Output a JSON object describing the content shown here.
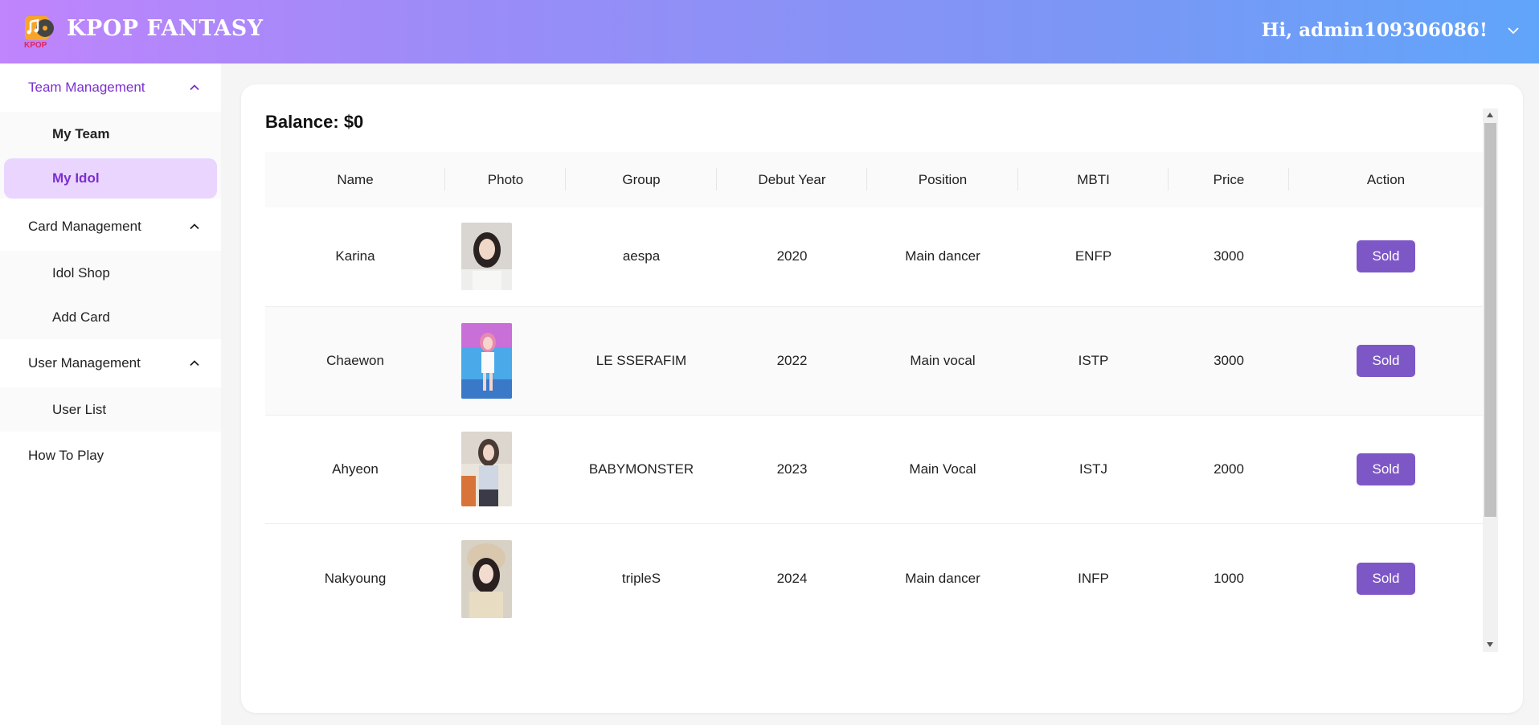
{
  "header": {
    "brand": "KPOP FANTASY",
    "logo_text": "KPOP",
    "greeting": "Hi, admin109306086!"
  },
  "sidebar": {
    "groups": [
      {
        "label": "Team Management",
        "items": [
          "My Team",
          "My Idol"
        ]
      },
      {
        "label": "Card Management",
        "items": [
          "Idol Shop",
          "Add Card"
        ]
      },
      {
        "label": "User Management",
        "items": [
          "User List"
        ]
      }
    ],
    "how_to_play": "How To Play"
  },
  "main": {
    "balance": "Balance: $0",
    "columns": [
      "Name",
      "Photo",
      "Group",
      "Debut Year",
      "Position",
      "MBTI",
      "Price",
      "Action"
    ],
    "rows": [
      {
        "name": "Karina",
        "group": "aespa",
        "debut": "2020",
        "position": "Main dancer",
        "mbti": "ENFP",
        "price": "3000",
        "action": "Sold"
      },
      {
        "name": "Chaewon",
        "group": "LE SSERAFIM",
        "debut": "2022",
        "position": "Main vocal",
        "mbti": "ISTP",
        "price": "3000",
        "action": "Sold"
      },
      {
        "name": "Ahyeon",
        "group": "BABYMONSTER",
        "debut": "2023",
        "position": "Main Vocal",
        "mbti": "ISTJ",
        "price": "2000",
        "action": "Sold"
      },
      {
        "name": "Nakyoung",
        "group": "tripleS",
        "debut": "2024",
        "position": "Main dancer",
        "mbti": "INFP",
        "price": "1000",
        "action": "Sold"
      }
    ]
  },
  "colors": {
    "accent": "#7b2fd0",
    "button": "#7e57c7",
    "selected_bg": "#ead5ff"
  }
}
